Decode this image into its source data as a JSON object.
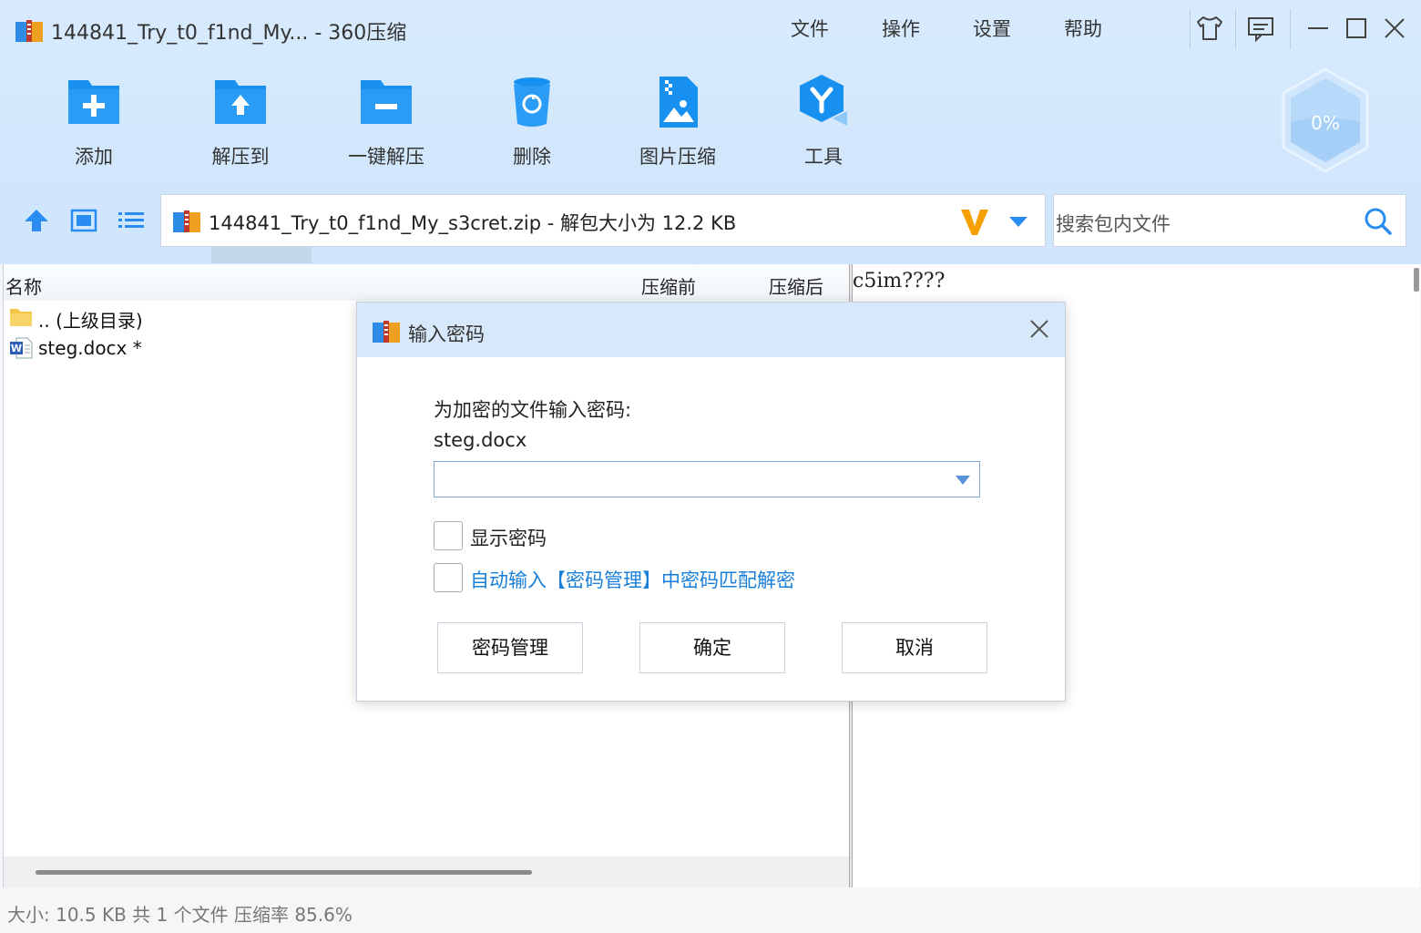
{
  "window": {
    "title": "144841_Try_t0_f1nd_My... - 360压缩",
    "menu": [
      "文件",
      "操作",
      "设置",
      "帮助"
    ]
  },
  "toolbar": {
    "items": [
      {
        "label": "添加",
        "icon": "add-folder-icon"
      },
      {
        "label": "解压到",
        "icon": "extract-to-icon"
      },
      {
        "label": "一键解压",
        "icon": "one-click-extract-icon"
      },
      {
        "label": "删除",
        "icon": "delete-icon"
      },
      {
        "label": "图片压缩",
        "icon": "image-compress-icon"
      },
      {
        "label": "工具",
        "icon": "tools-icon"
      }
    ],
    "progress_badge": "0%"
  },
  "address": {
    "path": "144841_Try_t0_f1nd_My_s3cret.zip - 解包大小为 12.2 KB"
  },
  "search": {
    "placeholder": "搜索包内文件"
  },
  "file_list": {
    "columns": [
      "名称",
      "压缩前",
      "压缩后"
    ],
    "rows": [
      {
        "name": ".. (上级目录)",
        "icon": "folder-icon"
      },
      {
        "name": "steg.docx *",
        "icon": "word-doc-icon"
      }
    ]
  },
  "preview": {
    "text": "c5im????"
  },
  "status": {
    "text": "大小: 10.5 KB 共 1 个文件 压缩率 85.6%"
  },
  "dialog": {
    "title": "输入密码",
    "prompt": "为加密的文件输入密码:",
    "filename": "steg.docx",
    "password_value": "",
    "show_password_label": "显示密码",
    "auto_fill_label": "自动输入【密码管理】中密码匹配解密",
    "buttons": {
      "manage": "密码管理",
      "ok": "确定",
      "cancel": "取消"
    }
  },
  "colors": {
    "accent_blue": "#1890f0",
    "link_blue": "#1a7fd8",
    "title_bg": "#d6e8fa",
    "v_badge": "#f5a000"
  }
}
